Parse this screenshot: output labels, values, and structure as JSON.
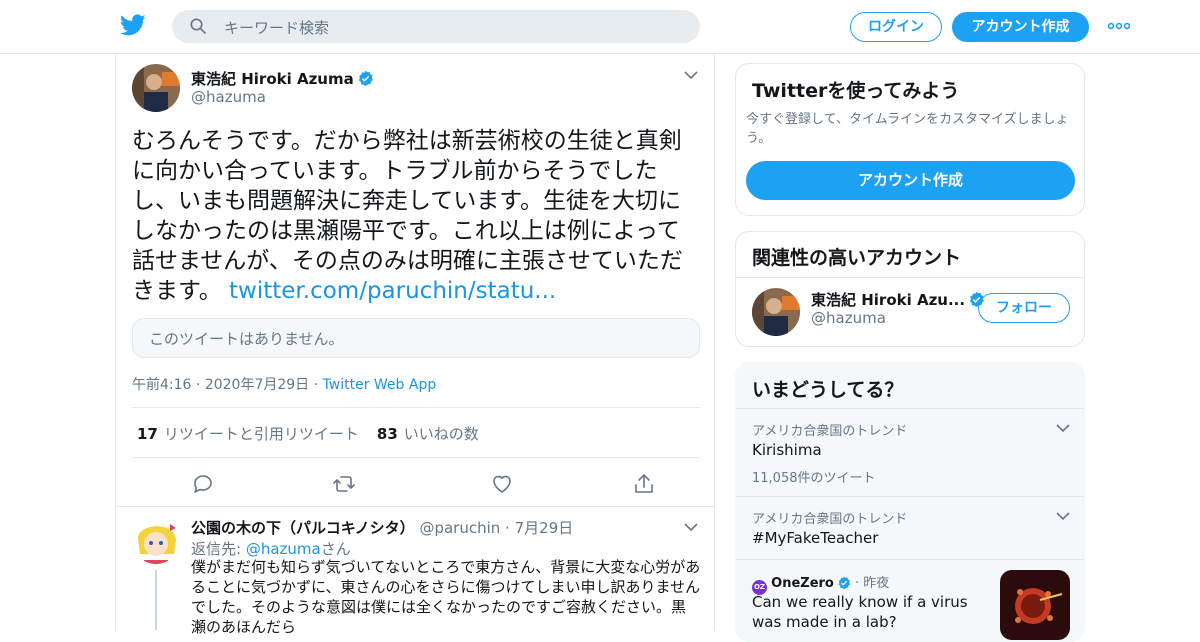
{
  "header": {
    "search_placeholder": "キーワード検索",
    "login_label": "ログイン",
    "signup_label": "アカウント作成"
  },
  "tweet": {
    "author_name": "東浩紀 Hiroki Azuma",
    "author_handle": "@hazuma",
    "text": "むろんそうです。だから弊社は新芸術校の生徒と真剣に向かい合っています。トラブル前からそうでしたし、いまも問題解決に奔走しています。生徒を大切にしなかったのは黒瀬陽平です。これ以上は例によって話せませんが、その点のみは明確に主張させていただきます。",
    "link": "twitter.com/paruchin/statu...",
    "quote_unavailable": "このツイートはありません。",
    "time": "午前4:16",
    "date": "2020年7月29日",
    "source": "Twitter Web App",
    "retweet_count": "17",
    "retweet_label": "リツイートと引用リツイート",
    "like_count": "83",
    "like_label": "いいねの数"
  },
  "reply": {
    "author_name": "公園の木の下（パルコキノシタ）",
    "author_handle": "@paruchin",
    "date": "7月29日",
    "reply_to_prefix": "返信先: ",
    "reply_to_handle": "@hazuma",
    "reply_to_suffix": "さん",
    "text": "僕がまだ何も知らず気づいてないところで東方さん、背景に大変な心労があることに気づかずに、東さんの心をさらに傷つけてしまい申し訳ありませんでした。そのような意図は僕には全くなかったのですご容赦ください。黒瀬のあほんだら"
  },
  "sidebar": {
    "signup_card": {
      "title": "Twitterを使ってみよう",
      "description": "今すぐ登録して、タイムラインをカスタマイズしましょう。",
      "button": "アカウント作成"
    },
    "related": {
      "title": "関連性の高いアカウント",
      "name": "東浩紀 Hiroki Azu...",
      "handle": "@hazuma",
      "follow_label": "フォロー"
    },
    "trends": {
      "title": "いまどうしてる？",
      "items": [
        {
          "context": "アメリカ合衆国のトレンド",
          "name": "Kirishima",
          "count": "11,058件のツイート"
        },
        {
          "context": "アメリカ合衆国のトレンド",
          "name": "#MyFakeTeacher"
        }
      ],
      "news": {
        "source_badge": "OZ",
        "source": "OneZero",
        "time": "昨夜",
        "title": "Can we really know if a virus was made in a lab?"
      }
    }
  },
  "colors": {
    "accent": "#1da1f2",
    "link": "#1b95e0",
    "muted": "#657786"
  },
  "icons": [
    "twitter-logo-icon",
    "search-icon",
    "more-icon",
    "verified-icon",
    "chevron-down-icon",
    "reply-icon",
    "retweet-icon",
    "like-icon",
    "share-icon"
  ]
}
